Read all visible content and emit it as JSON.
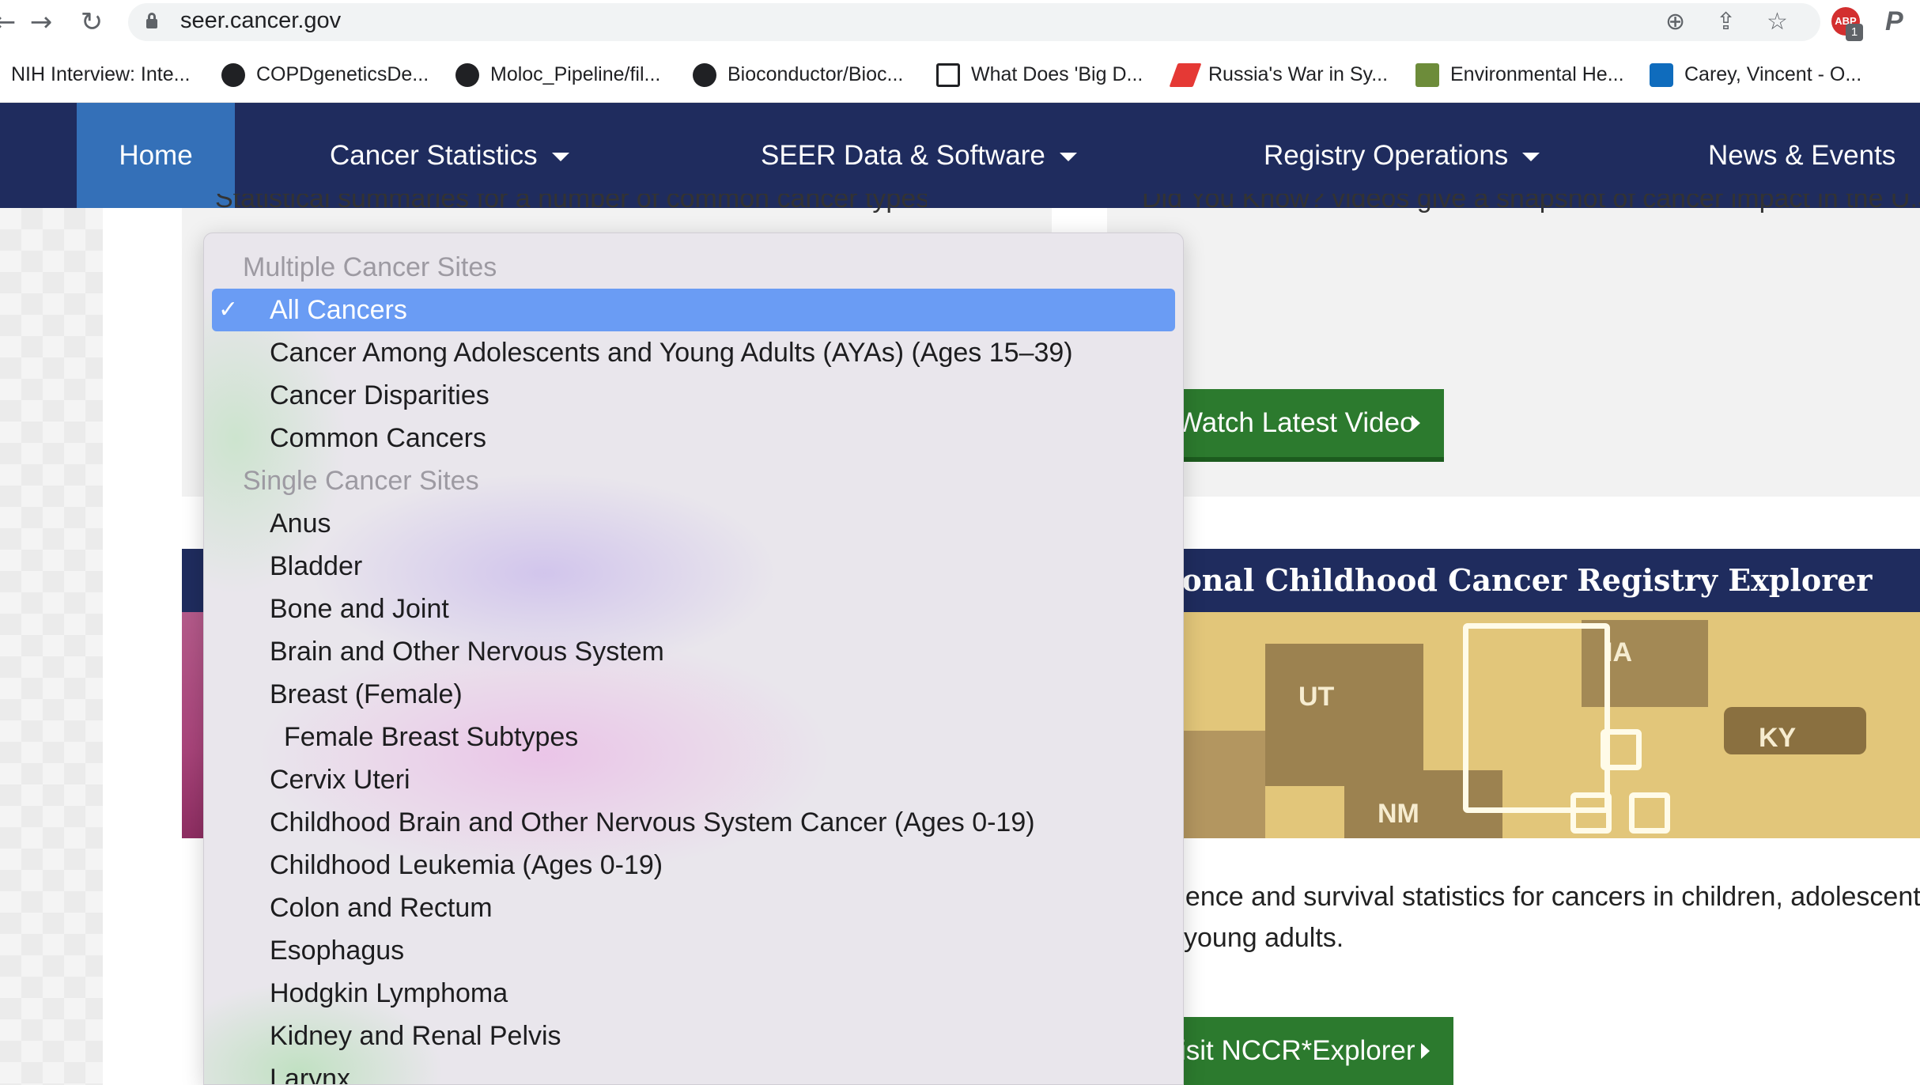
{
  "browser": {
    "url": "seer.cancer.gov",
    "nav": {
      "back": "←",
      "forward": "→",
      "reload": "↻"
    },
    "right_icons": {
      "zoom": "⊕",
      "share": "⇪",
      "star": "☆",
      "abp_label": "ABP",
      "abp_count": "1",
      "ext_p": "P"
    },
    "bookmarks": [
      {
        "label": "NIH Interview: Inte...",
        "icon": "folder-icon"
      },
      {
        "label": "COPDgeneticsDe...",
        "icon": "github-icon"
      },
      {
        "label": "Moloc_Pipeline/fil...",
        "icon": "github-icon"
      },
      {
        "label": "Bioconductor/Bioc...",
        "icon": "github-icon"
      },
      {
        "label": "What Does 'Big D...",
        "icon": "c-icon"
      },
      {
        "label": "Russia's War in Sy...",
        "icon": "flag-icon"
      },
      {
        "label": "Environmental He...",
        "icon": "env-icon"
      },
      {
        "label": "Carey, Vincent - O...",
        "icon": "outlook-icon"
      }
    ]
  },
  "site_nav": {
    "home": "Home",
    "cancer_statistics": "Cancer Statistics",
    "seer_data": "SEER Data & Software",
    "registry_ops": "Registry Operations",
    "news_events": "News & Events"
  },
  "page": {
    "stat_summary_text": "Statistical summaries for a number of common cancer types.",
    "did_you_know_text": "Did You Know? videos give a snapshot of cancer impact in the U.S.",
    "video_button": "Watch Latest Video",
    "explorer_title": "ional Childhood Cancer Registry Explorer",
    "map_labels": {
      "ut": "UT",
      "nm": "NM",
      "ia": "IA",
      "ky": "KY"
    },
    "explorer_desc_line1": "dence and survival statistics for cancers in children, adolescents",
    "explorer_desc_line2": "l young adults.",
    "nccr_button": "isit NCCR*Explorer"
  },
  "dropdown": {
    "check": "✓",
    "group_multiple": "Multiple Cancer Sites",
    "selected": "All Cancers",
    "multiple_options": [
      "Cancer Among Adolescents and Young Adults (AYAs) (Ages 15–39)",
      "Cancer Disparities",
      "Common Cancers"
    ],
    "group_single": "Single Cancer Sites",
    "single_options_a": [
      "Anus",
      "Bladder",
      "Bone and Joint",
      "Brain and Other Nervous System",
      "Breast (Female)"
    ],
    "sub_option": "Female Breast Subtypes",
    "single_options_b": [
      "Cervix Uteri",
      "Childhood Brain and Other Nervous System Cancer (Ages 0-19)",
      "Childhood Leukemia (Ages 0-19)",
      "Colon and Rectum",
      "Esophagus",
      "Hodgkin Lymphoma",
      "Kidney and Renal Pelvis",
      "Larynx"
    ]
  }
}
